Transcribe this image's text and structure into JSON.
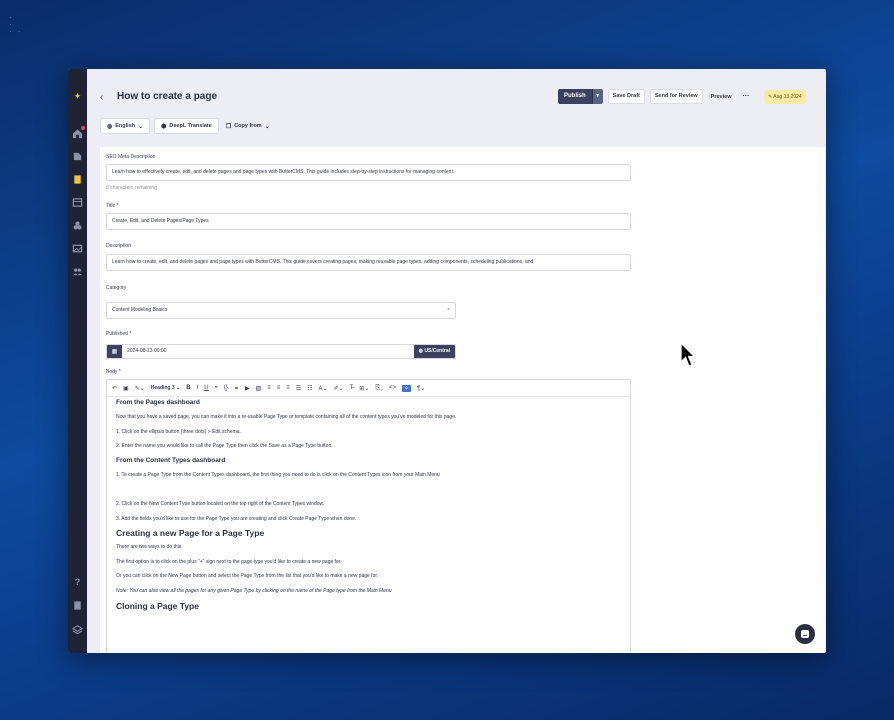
{
  "page": {
    "title": "How to create a page",
    "back_glyph": "‹"
  },
  "header": {
    "publish_label": "Publish",
    "publish_arrow": "▾",
    "save_draft_label": "Save Draft",
    "send_review_label": "Send for Review",
    "preview_label": "Preview",
    "more_glyph": "···",
    "date_chip": "✎ Aug 13 2024"
  },
  "subtoolbar": {
    "language_label": "English",
    "deepl_label": "DeepL Translate",
    "copy_label": "Copy from"
  },
  "form": {
    "seo_label": "SEO Meta Description",
    "seo_value": "Learn how to effectively create, edit, and delete pages and page types with ButterCMS. This guide includes step-by-step instructions for managing content.",
    "seo_helper": "0 characters remaining",
    "title_label": "Title *",
    "title_value": "Create, Edit, and Delete Pages/Page Types",
    "description_label": "Description",
    "description_value": "Learn how to create, edit, and delete pages and page types with ButterCMS. This guide covers creating pages, making reusable page types, adding components, scheduling publications, and",
    "category_label": "Category",
    "category_value": "Content Modeling Basics",
    "category_clear": "×",
    "published_label": "Published *",
    "published_value": "2024-08-13 00:00",
    "timezone_label": "US/Central",
    "body_label": "Body *"
  },
  "editor": {
    "heading_select": "Heading 3",
    "lines": [
      {
        "type": "h3",
        "text": "From the Pages dashboard"
      },
      {
        "type": "p",
        "text": "Now that you have a saved page, you can make it into a re-usable Page Type or template containing all of the content types you've modeled for this page."
      },
      {
        "type": "p",
        "text": "1. Click on the ellipsis button (three dots) > Edit schema."
      },
      {
        "type": "p",
        "text": "2. Enter the name you would like to call the Page Type then click the Save as a Page Type button."
      },
      {
        "type": "h3",
        "text": "From the Content Types dashboard"
      },
      {
        "type": "p",
        "text": "1. To create a Page Type from the Content Types dashboard, the first thing you need to do is click on the Content Types icon from your Main Menu"
      },
      {
        "type": "spacer",
        "text": ""
      },
      {
        "type": "p",
        "text": "2. Click on the New Content Type button located on the top right of the Content Types window."
      },
      {
        "type": "p",
        "text": "3. Add the fields you'd like to use for the Page Type you are creating and click Create Page Type when done."
      },
      {
        "type": "h2",
        "text": "Creating a new Page for a Page Type"
      },
      {
        "type": "p",
        "text": "There are two ways to do this."
      },
      {
        "type": "p",
        "text": "The first option is to click on the plus \"+\" sign next to the page type you'd like to create a new page for."
      },
      {
        "type": "p",
        "text": "Or you can click on the New Page button and select the Page Type from the list that you'd like to make a new page for."
      },
      {
        "type": "em",
        "text": "Note: You can also view all the pages for any given Page Type by clicking on the name of the Page type from the Main Menu"
      },
      {
        "type": "h2",
        "text": "Cloning a Page Type"
      }
    ]
  },
  "colors": {
    "sidebar": "#1e2435",
    "primary_button": "#3a4260",
    "date_chip": "#fbeaa6",
    "background": "#0e4a9e"
  }
}
